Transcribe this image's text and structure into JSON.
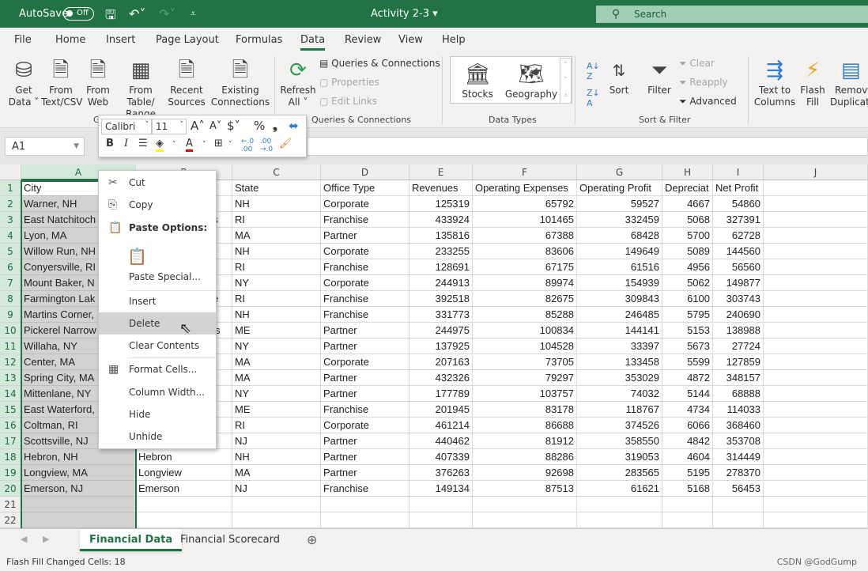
{
  "titlebar": {
    "autosave": "AutoSave",
    "toggle": "Off",
    "title": "Activity 2-3 ▾",
    "search": "Search"
  },
  "tabs": [
    "File",
    "Home",
    "Insert",
    "Page Layout",
    "Formulas",
    "Data",
    "Review",
    "View",
    "Help"
  ],
  "active_tab": "Data",
  "ribbon": {
    "get_data": [
      "Get",
      "Data ˅"
    ],
    "from_text": [
      "From",
      "Text/CSV"
    ],
    "from_web": [
      "From",
      "Web"
    ],
    "from_table": [
      "From Table/",
      "Range"
    ],
    "recent": [
      "Recent",
      "Sources"
    ],
    "existing": [
      "Existing",
      "Connections"
    ],
    "refresh": [
      "Refresh",
      "All ˅"
    ],
    "queries": "Queries & Connections",
    "properties": "Properties",
    "edit_links": "Edit Links",
    "group_queries": "Queries & Connections",
    "group_get": "G",
    "stocks": "Stocks",
    "geography": "Geography",
    "group_types": "Data Types",
    "sort": "Sort",
    "filter": "Filter",
    "clear": "Clear",
    "reapply": "Reapply",
    "advanced": "Advanced",
    "group_sort": "Sort & Filter",
    "text_to_columns": [
      "Text to",
      "Columns"
    ],
    "flash_fill": [
      "Flash",
      "Fill"
    ],
    "remove_dup": [
      "Remove",
      "Duplicate"
    ]
  },
  "namebox": "A1",
  "mini_toolbar": {
    "font": "Calibri",
    "size": "11"
  },
  "columns": [
    "A",
    "B",
    "C",
    "D",
    "E",
    "F",
    "G",
    "H",
    "I",
    "J"
  ],
  "rows": [
    [
      "City",
      "",
      "State",
      "Office Type",
      "Revenues",
      "Operating Expenses",
      "Operating Profit",
      "Depreciat",
      "Net Profit"
    ],
    [
      "Warner, NH",
      "",
      "NH",
      "Corporate",
      "125319",
      "65792",
      "59527",
      "4667",
      "54860"
    ],
    [
      "East Natchitoch",
      "es",
      "RI",
      "Franchise",
      "433924",
      "101465",
      "332459",
      "5068",
      "327391"
    ],
    [
      "Lyon, MA",
      "",
      "MA",
      "Partner",
      "135816",
      "67388",
      "68428",
      "5700",
      "62728"
    ],
    [
      "Willow Run, NH",
      "",
      "NH",
      "Corporate",
      "233255",
      "83606",
      "149649",
      "5089",
      "144560"
    ],
    [
      "Conyersville, RI",
      "",
      "RI",
      "Franchise",
      "128691",
      "67175",
      "61516",
      "4956",
      "56560"
    ],
    [
      "Mount Baker, N",
      "",
      "NY",
      "Corporate",
      "244913",
      "89974",
      "154939",
      "5062",
      "149877"
    ],
    [
      "Farmington Lak",
      "e",
      "RI",
      "Franchise",
      "392518",
      "82675",
      "309843",
      "6100",
      "303743"
    ],
    [
      "Martins Corner,",
      "",
      "NH",
      "Franchise",
      "331773",
      "85288",
      "246485",
      "5795",
      "240690"
    ],
    [
      "Pickerel Narrow",
      "s",
      "ME",
      "Partner",
      "244975",
      "100834",
      "144141",
      "5153",
      "138988"
    ],
    [
      "Willaha, NY",
      "",
      "NY",
      "Partner",
      "137925",
      "104528",
      "33397",
      "5673",
      "27724"
    ],
    [
      "Center, MA",
      "",
      "MA",
      "Corporate",
      "207163",
      "73705",
      "133458",
      "5599",
      "127859"
    ],
    [
      "Spring City, MA",
      "",
      "MA",
      "Partner",
      "432326",
      "79297",
      "353029",
      "4872",
      "348157"
    ],
    [
      "Mittenlane, NY",
      "",
      "NY",
      "Partner",
      "177789",
      "103757",
      "74032",
      "5144",
      "68888"
    ],
    [
      "East Waterford,",
      "",
      "ME",
      "Franchise",
      "201945",
      "83178",
      "118767",
      "4734",
      "114033"
    ],
    [
      "Coltman, RI",
      "",
      "RI",
      "Corporate",
      "461214",
      "86688",
      "374526",
      "6066",
      "368460"
    ],
    [
      "Scottsville, NJ",
      "",
      "NJ",
      "Partner",
      "440462",
      "81912",
      "358550",
      "4842",
      "353708"
    ],
    [
      "Hebron, NH",
      "Hebron",
      "NH",
      "Partner",
      "407339",
      "88286",
      "319053",
      "4604",
      "314449"
    ],
    [
      "Longview, MA",
      "Longview",
      "MA",
      "Partner",
      "376263",
      "92698",
      "283565",
      "5195",
      "278370"
    ],
    [
      "Emerson, NJ",
      "Emerson",
      "NJ",
      "Franchise",
      "149134",
      "87513",
      "61621",
      "5168",
      "56453"
    ],
    [
      "",
      "",
      "",
      "",
      "",
      "",
      "",
      "",
      ""
    ],
    [
      "",
      "",
      "",
      "",
      "",
      "",
      "",
      "",
      ""
    ],
    [
      "",
      "",
      "",
      "",
      "",
      "",
      "",
      "",
      ""
    ]
  ],
  "context_menu": [
    {
      "label": "Cut",
      "icon": "scissors-icon"
    },
    {
      "label": "Copy",
      "icon": "copy-icon"
    },
    {
      "label": "Paste Options:",
      "icon": "paste-icon"
    },
    {
      "label": "",
      "icon": "paste-default-icon"
    },
    {
      "label": "Paste Special..."
    },
    {
      "label": "Insert"
    },
    {
      "label": "Delete"
    },
    {
      "label": "Clear Contents"
    },
    {
      "label": "Format Cells...",
      "icon": "format-cells-icon"
    },
    {
      "label": "Column Width..."
    },
    {
      "label": "Hide"
    },
    {
      "label": "Unhide"
    }
  ],
  "sheets": [
    "Financial Data",
    "Financial Scorecard"
  ],
  "status": "Flash Fill Changed Cells: 18",
  "watermark": "CSDN @GodGump",
  "colors": {
    "brand": "#217346",
    "selection": "#d2d2d2"
  }
}
